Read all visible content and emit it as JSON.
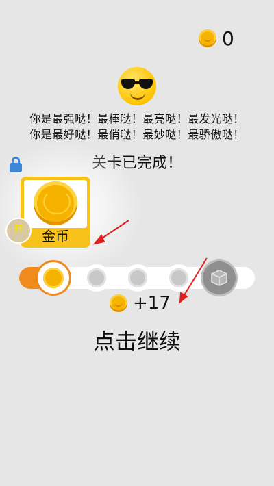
{
  "header": {
    "coin_total": "0",
    "coin_icon": "coin-icon"
  },
  "praise": {
    "line1": "你是最强哒！最棒哒！最亮哒！最发光哒！",
    "line2": "你是最好哒！最俏哒！最妙哒！最骄傲哒！"
  },
  "level": {
    "status": "关卡已完成！"
  },
  "reward_card": {
    "label": "金币",
    "icon": "coin-icon"
  },
  "badge": {
    "text": "开"
  },
  "progress": {
    "fill_fraction": 0.13,
    "nodes": [
      "coin-active",
      "coin-locked",
      "coin-locked",
      "coin-locked",
      "gift-box"
    ]
  },
  "reward": {
    "amount": "+17"
  },
  "actions": {
    "continue_label": "点击继续"
  },
  "colors": {
    "accent": "#f08a1c",
    "coin": "#f5b300",
    "card": "#f8c21c",
    "lock": "#3d86d8",
    "arrow": "#e01e1e"
  }
}
